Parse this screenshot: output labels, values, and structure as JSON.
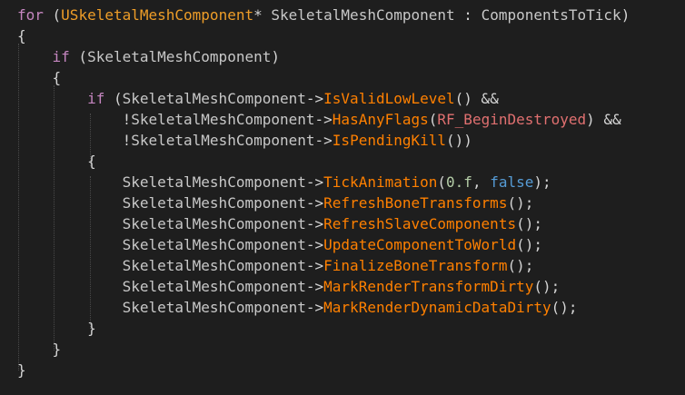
{
  "editor": {
    "lines": [
      [
        {
          "t": "for",
          "c": "kw"
        },
        {
          "t": " (",
          "c": "p"
        },
        {
          "t": "USkeletalMeshComponent",
          "c": "type"
        },
        {
          "t": "* ",
          "c": "p"
        },
        {
          "t": "SkeletalMeshComponent",
          "c": "id"
        },
        {
          "t": " : ",
          "c": "p"
        },
        {
          "t": "ComponentsToTick",
          "c": "id"
        },
        {
          "t": ")",
          "c": "p"
        }
      ],
      [
        {
          "t": "{",
          "c": "p"
        }
      ],
      [
        {
          "t": "    if",
          "c": "kw"
        },
        {
          "t": " (",
          "c": "p"
        },
        {
          "t": "SkeletalMeshComponent",
          "c": "id"
        },
        {
          "t": ")",
          "c": "p"
        }
      ],
      [
        {
          "t": "    {",
          "c": "p"
        }
      ],
      [
        {
          "t": "        if",
          "c": "kw"
        },
        {
          "t": " (",
          "c": "p"
        },
        {
          "t": "SkeletalMeshComponent",
          "c": "id"
        },
        {
          "t": "->",
          "c": "p"
        },
        {
          "t": "IsValidLowLevel",
          "c": "fn"
        },
        {
          "t": "() &&",
          "c": "p"
        }
      ],
      [
        {
          "t": "            !",
          "c": "p"
        },
        {
          "t": "SkeletalMeshComponent",
          "c": "id"
        },
        {
          "t": "->",
          "c": "p"
        },
        {
          "t": "HasAnyFlags",
          "c": "fn"
        },
        {
          "t": "(",
          "c": "p"
        },
        {
          "t": "RF_BeginDestroyed",
          "c": "enum"
        },
        {
          "t": ") &&",
          "c": "p"
        }
      ],
      [
        {
          "t": "            !",
          "c": "p"
        },
        {
          "t": "SkeletalMeshComponent",
          "c": "id"
        },
        {
          "t": "->",
          "c": "p"
        },
        {
          "t": "IsPendingKill",
          "c": "fn"
        },
        {
          "t": "())",
          "c": "p"
        }
      ],
      [
        {
          "t": "        {",
          "c": "p"
        }
      ],
      [
        {
          "t": "            ",
          "c": "p"
        },
        {
          "t": "SkeletalMeshComponent",
          "c": "id"
        },
        {
          "t": "->",
          "c": "p"
        },
        {
          "t": "TickAnimation",
          "c": "fn"
        },
        {
          "t": "(",
          "c": "p"
        },
        {
          "t": "0.f",
          "c": "num"
        },
        {
          "t": ", ",
          "c": "p"
        },
        {
          "t": "false",
          "c": "kw2"
        },
        {
          "t": ");",
          "c": "p"
        }
      ],
      [
        {
          "t": "            ",
          "c": "p"
        },
        {
          "t": "SkeletalMeshComponent",
          "c": "id"
        },
        {
          "t": "->",
          "c": "p"
        },
        {
          "t": "RefreshBoneTransforms",
          "c": "fn"
        },
        {
          "t": "();",
          "c": "p"
        }
      ],
      [
        {
          "t": "            ",
          "c": "p"
        },
        {
          "t": "SkeletalMeshComponent",
          "c": "id"
        },
        {
          "t": "->",
          "c": "p"
        },
        {
          "t": "RefreshSlaveComponents",
          "c": "fn"
        },
        {
          "t": "();",
          "c": "p"
        }
      ],
      [
        {
          "t": "            ",
          "c": "p"
        },
        {
          "t": "SkeletalMeshComponent",
          "c": "id"
        },
        {
          "t": "->",
          "c": "p"
        },
        {
          "t": "UpdateComponentToWorld",
          "c": "fn"
        },
        {
          "t": "();",
          "c": "p"
        }
      ],
      [
        {
          "t": "            ",
          "c": "p"
        },
        {
          "t": "SkeletalMeshComponent",
          "c": "id"
        },
        {
          "t": "->",
          "c": "p"
        },
        {
          "t": "FinalizeBoneTransform",
          "c": "fn"
        },
        {
          "t": "();",
          "c": "p"
        }
      ],
      [
        {
          "t": "            ",
          "c": "p"
        },
        {
          "t": "SkeletalMeshComponent",
          "c": "id"
        },
        {
          "t": "->",
          "c": "p"
        },
        {
          "t": "MarkRenderTransformDirty",
          "c": "fn"
        },
        {
          "t": "();",
          "c": "p"
        }
      ],
      [
        {
          "t": "            ",
          "c": "p"
        },
        {
          "t": "SkeletalMeshComponent",
          "c": "id"
        },
        {
          "t": "->",
          "c": "p"
        },
        {
          "t": "MarkRenderDynamicDataDirty",
          "c": "fn"
        },
        {
          "t": "();",
          "c": "p"
        }
      ],
      [
        {
          "t": "        }",
          "c": "p"
        }
      ],
      [
        {
          "t": "    }",
          "c": "p"
        }
      ],
      [
        {
          "t": "}",
          "c": "p"
        }
      ]
    ]
  },
  "theme": {
    "background": "#1e1e1e",
    "keyword": "#c586c0",
    "type": "#ee9d28",
    "function": "#ff8000"
  }
}
